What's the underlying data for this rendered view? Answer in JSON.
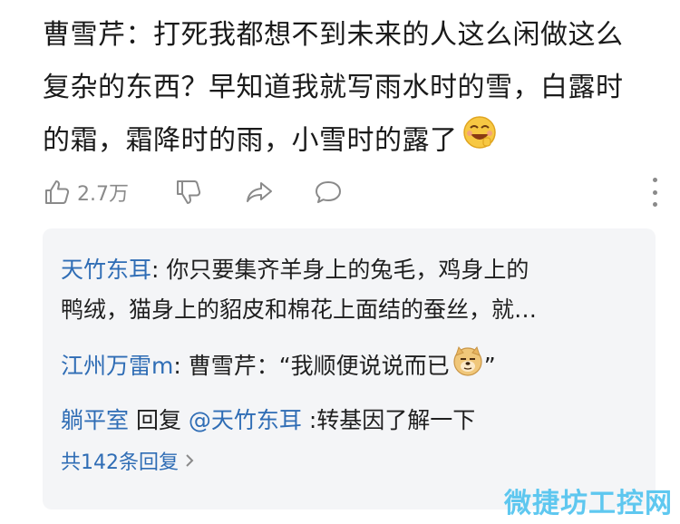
{
  "post": {
    "line1": "曹雪芹：打死我都想不到未来的人这么闲做这么",
    "line2": "复杂的东西？早知道我就写雨水时的雪，白露时",
    "line3": "的霜，霜降时的雨，小雪时的露了"
  },
  "actions": {
    "like_count": "2.7万"
  },
  "replies": [
    {
      "name": "天竹东耳",
      "text_line1": ": 你只要集齐羊身上的兔毛，鸡身上的",
      "text_line2": "鸭绒，猫身上的貂皮和棉花上面结的蚕丝，就…"
    },
    {
      "name": "江州万雷m",
      "text": ": 曹雪芹：“我顺便说说而已",
      "text_tail": "”"
    },
    {
      "name": "躺平室",
      "reply_word": " 回复 ",
      "mention": "@天竹东耳",
      "text": " :转基因了解一下"
    }
  ],
  "more_replies": "共142条回复",
  "watermark": "微捷坊工控网",
  "colors": {
    "link_blue": "#2f6db5",
    "gray_icon": "#8a8a8a",
    "reply_bg": "#f4f5f7",
    "watermark": "#52c4ef"
  },
  "icons": [
    "laughing-emoji-icon",
    "like-icon",
    "dislike-icon",
    "share-icon",
    "comment-icon",
    "more-icon",
    "doge-emoji-icon",
    "chevron-right-icon"
  ]
}
